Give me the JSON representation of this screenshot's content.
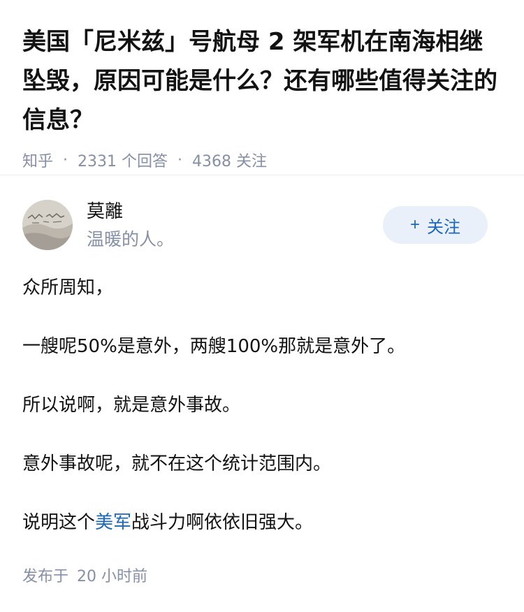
{
  "question": {
    "title": "美国「尼米兹」号航母 2 架军机在南海相继坠毁，原因可能是什么？还有哪些值得关注的信息？",
    "source": "知乎",
    "separator": "·",
    "answers_count": "2331 个回答",
    "followers_count": "4368 关注"
  },
  "author": {
    "name": "莫離",
    "bio": "温暖的人。",
    "follow_plus": "+",
    "follow_label": "关注"
  },
  "answer": {
    "p1": "众所周知，",
    "p2": "一艘呢50%是意外，两艘100%那就是意外了。",
    "p3": "所以说啊，就是意外事故。",
    "p4": "意外事故呢，就不在这个统计范围内。",
    "p5_prefix": "说明这个",
    "p5_link": "美军",
    "p5_suffix": "战斗力啊依依旧强大。"
  },
  "footer": {
    "published_label": "发布于",
    "published_time": "20 小时前"
  },
  "colors": {
    "accent": "#1b67b9",
    "meta_gray": "#8590a6",
    "follow_bg": "#e9f0fa"
  }
}
